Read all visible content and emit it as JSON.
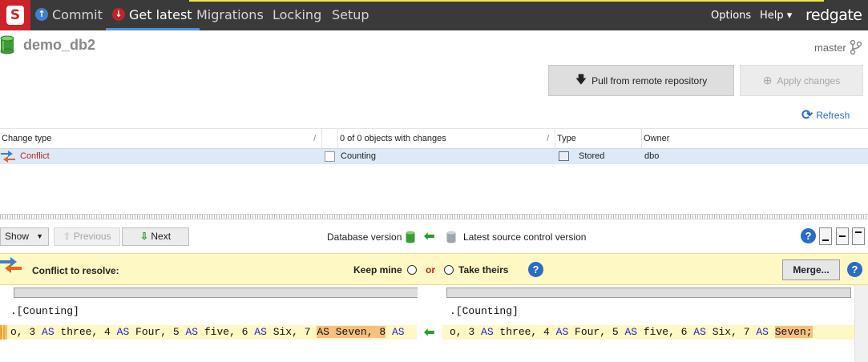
{
  "nav": {
    "logo_letter": "S",
    "tabs": [
      {
        "label": "Commit",
        "icon": "commit-up-arrow-icon"
      },
      {
        "label": "Get latest",
        "icon": "get-latest-down-arrow-icon",
        "active": true
      },
      {
        "label": "Migrations"
      },
      {
        "label": "Locking"
      },
      {
        "label": "Setup"
      }
    ],
    "options_label": "Options",
    "help_label": "Help ▾",
    "brand": "redgate"
  },
  "header": {
    "db_name": "demo_db2",
    "branch": "master",
    "pull_label": "Pull from remote repository",
    "apply_label": "Apply changes",
    "refresh_label": "Refresh"
  },
  "grid": {
    "columns": [
      "Change type",
      "0 of 0 objects with changes",
      "Type",
      "Owner"
    ],
    "rows": [
      {
        "change_type": "Conflict",
        "object": "Counting",
        "type": "Stored",
        "owner": "dbo"
      }
    ]
  },
  "toolbar": {
    "show_label": "Show",
    "previous_label": "Previous",
    "next_label": "Next",
    "db_version_label": "Database version",
    "source_version_label": "Latest source control version",
    "help_glyph": "?"
  },
  "conflict": {
    "title": "Conflict to resolve:",
    "keep_mine": "Keep mine",
    "or": "or",
    "take_theirs": "Take theirs",
    "merge_label": "Merge...",
    "help_glyph": "?"
  },
  "diff": {
    "left_name": ".[Counting]",
    "right_name": ".[Counting]",
    "left_line": [
      {
        "t": "o, 3 "
      },
      {
        "t": "AS",
        "kw": true
      },
      {
        "t": " three, 4 "
      },
      {
        "t": "AS",
        "kw": true
      },
      {
        "t": " Four, 5 "
      },
      {
        "t": "AS",
        "kw": true
      },
      {
        "t": " five, 6 "
      },
      {
        "t": "AS",
        "kw": true
      },
      {
        "t": " Six, 7 "
      },
      {
        "t": "AS Seven, 8",
        "hl": true
      },
      {
        "t": " "
      },
      {
        "t": "AS",
        "kw": true
      }
    ],
    "right_line": [
      {
        "t": "o, 3 "
      },
      {
        "t": "AS",
        "kw": true
      },
      {
        "t": " three, 4 "
      },
      {
        "t": "AS",
        "kw": true
      },
      {
        "t": " Four, 5 "
      },
      {
        "t": "AS",
        "kw": true
      },
      {
        "t": " five, 6 "
      },
      {
        "t": "AS",
        "kw": true
      },
      {
        "t": " Six, 7 "
      },
      {
        "t": "AS",
        "kw": true
      },
      {
        "t": " "
      },
      {
        "t": "Seven;",
        "hl": true
      }
    ]
  },
  "colors": {
    "nav_bg": "#3a3a3a",
    "logo_red": "#cc2229",
    "active_tab_underline": "#4a90d9",
    "conflict_red": "#cc1f1f",
    "conflict_banner": "#fdf8c4",
    "selected_row": "#dde9f7",
    "link_blue": "#2a6cc6",
    "diff_highlight": "#f6c17e"
  }
}
